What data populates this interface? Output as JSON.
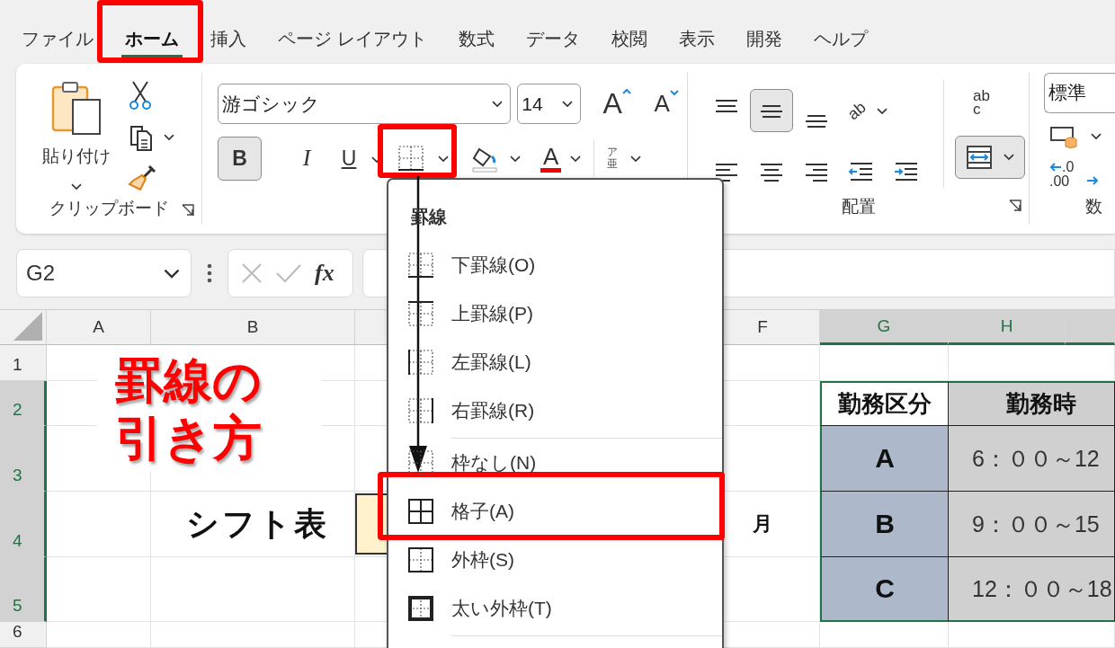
{
  "tabs": [
    {
      "label": "ファイル",
      "selected": false
    },
    {
      "label": "ホーム",
      "selected": true
    },
    {
      "label": "挿入",
      "selected": false
    },
    {
      "label": "ページ レイアウト",
      "selected": false
    },
    {
      "label": "数式",
      "selected": false
    },
    {
      "label": "データ",
      "selected": false
    },
    {
      "label": "校閲",
      "selected": false
    },
    {
      "label": "表示",
      "selected": false
    },
    {
      "label": "開発",
      "selected": false
    },
    {
      "label": "ヘルプ",
      "selected": false
    }
  ],
  "ribbon": {
    "clipboard": {
      "paste_label": "貼り付け",
      "group_label": "クリップボード"
    },
    "font": {
      "font_name": "游ゴシック",
      "font_size": "14",
      "grow": "A",
      "shrink": "A",
      "bold": "B",
      "bold_selected": true,
      "italic": "I",
      "underline": "U",
      "font_color": "A",
      "phonetic": [
        "ア",
        "亜"
      ]
    },
    "alignment": {
      "group_label": "配置",
      "orientation": "ab",
      "wrap": [
        "ab",
        "c"
      ],
      "vertical_buttons": [
        {
          "kind": "top",
          "selected": false
        },
        {
          "kind": "middle",
          "selected": true
        },
        {
          "kind": "bottom",
          "selected": false
        }
      ],
      "merge_selected": true
    },
    "number": {
      "format": "標準",
      "decimal": [
        ".0",
        ".00"
      ],
      "group_label": "数"
    }
  },
  "formula_bar": {
    "name_box": "G2",
    "function_label": "fx"
  },
  "sheet": {
    "columns": [
      {
        "label": "A",
        "selected": false
      },
      {
        "label": "B",
        "selected": false
      },
      {
        "label": "F",
        "selected": false
      },
      {
        "label": "G",
        "selected": true
      },
      {
        "label": "H",
        "selected": true
      },
      {
        "selected": true
      }
    ],
    "rows": [
      {
        "label": "1",
        "selected": false
      },
      {
        "label": "2",
        "selected": true
      },
      {
        "label": "3",
        "selected": true
      },
      {
        "label": "4",
        "selected": true
      },
      {
        "label": "5",
        "selected": true
      },
      {
        "label": "6",
        "selected": false
      }
    ],
    "shift_title": "シフト表",
    "weekday": "月",
    "table_header": [
      "勤務区分",
      "勤務時"
    ],
    "table_rows": [
      {
        "code": "A",
        "hours": "6：００～12"
      },
      {
        "code": "B",
        "hours": "9：００～15"
      },
      {
        "code": "C",
        "hours": "12：００～18"
      }
    ]
  },
  "title_overlay": [
    "罫線の",
    "引き方"
  ],
  "border_menu": {
    "title": "罫線",
    "items": [
      {
        "kind": "bottom",
        "label": "下罫線(O)",
        "separator_after": false
      },
      {
        "kind": "top",
        "label": "上罫線(P)",
        "separator_after": false
      },
      {
        "kind": "left",
        "label": "左罫線(L)",
        "separator_after": false
      },
      {
        "kind": "right",
        "label": "右罫線(R)",
        "separator_after": true
      },
      {
        "kind": "none",
        "label": "枠なし(N)",
        "separator_after": false
      },
      {
        "kind": "all",
        "label": "格子(A)",
        "separator_after": false
      },
      {
        "kind": "outside",
        "label": "外枠(S)",
        "separator_after": false
      },
      {
        "kind": "thick",
        "label": "太い外枠(T)",
        "separator_after": true
      }
    ]
  }
}
